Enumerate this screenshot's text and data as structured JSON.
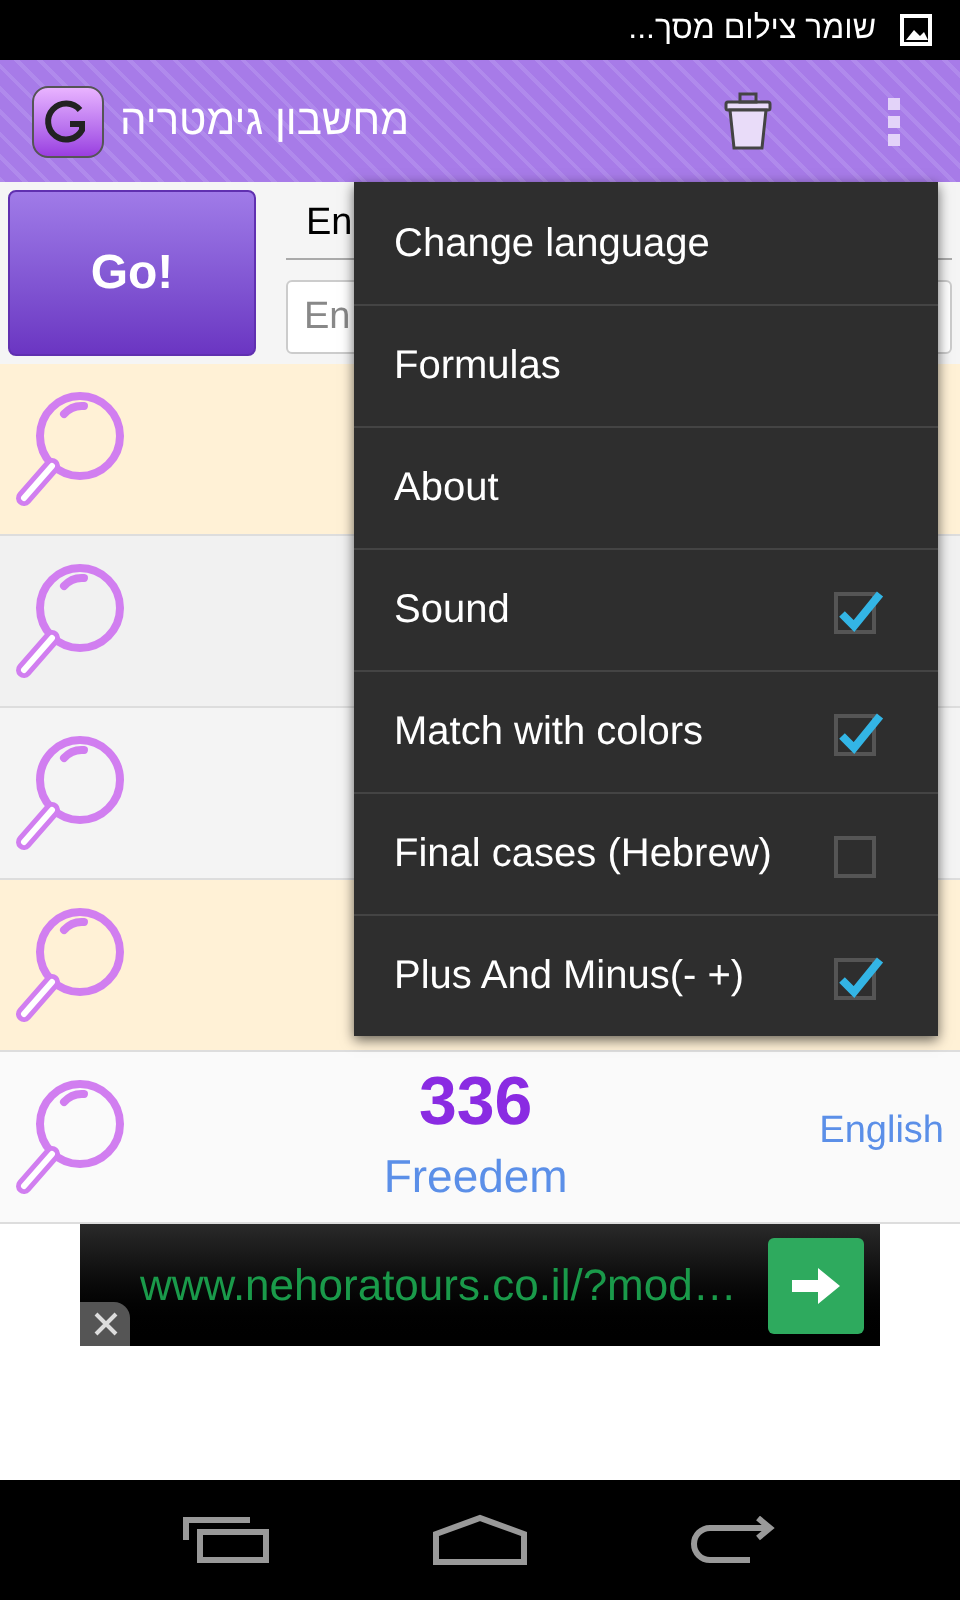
{
  "status_bar": {
    "notification": "שומר צילום מסך..."
  },
  "action_bar": {
    "title": "מחשבון גימטריה"
  },
  "controls": {
    "go_button": "Go!",
    "language_spinner": "En",
    "input": {
      "placeholder": "En"
    }
  },
  "rows": [
    {
      "color": "#fff1d6"
    },
    {
      "color": "#f1f1f1"
    },
    {
      "color": "#f4f4f4"
    },
    {
      "color": "#fff1d6"
    },
    {
      "color": "#fafafa",
      "value": "336",
      "word": "Freedem",
      "language": "English"
    }
  ],
  "menu": [
    {
      "kind": "plain",
      "label": "Change language"
    },
    {
      "kind": "plain",
      "label": "Formulas"
    },
    {
      "kind": "plain",
      "label": "About"
    },
    {
      "kind": "checkbox",
      "label": "Sound",
      "checked": true
    },
    {
      "kind": "checkbox",
      "label": "Match with colors",
      "checked": true
    },
    {
      "kind": "checkbox",
      "label": "Final cases (Hebrew)",
      "checked": false
    },
    {
      "kind": "checkbox",
      "label": "Plus And Minus(- +)",
      "checked": true
    }
  ],
  "ad": {
    "url": "www.nehoratours.co.il/?mod…"
  }
}
